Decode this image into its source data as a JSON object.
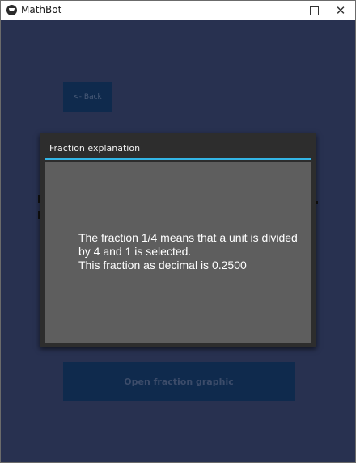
{
  "window": {
    "title": "MathBot",
    "icons": {
      "app": "app-logo-icon",
      "minimize": "minimize-icon",
      "maximize": "maximize-icon",
      "close": "close-icon"
    }
  },
  "main": {
    "back_label": "<- Back",
    "open_graphic_label": "Open fraction graphic"
  },
  "modal": {
    "title": "Fraction explanation",
    "message": "The fraction 1/4 means that a unit is divided by 4 and 1 is selected.\nThis fraction as decimal is 0.2500"
  },
  "colors": {
    "background": "#283150",
    "button": "#0f2a4d",
    "modal_frame": "#2d2d2d",
    "modal_body": "#5e5e5e",
    "accent": "#33b5e5"
  }
}
